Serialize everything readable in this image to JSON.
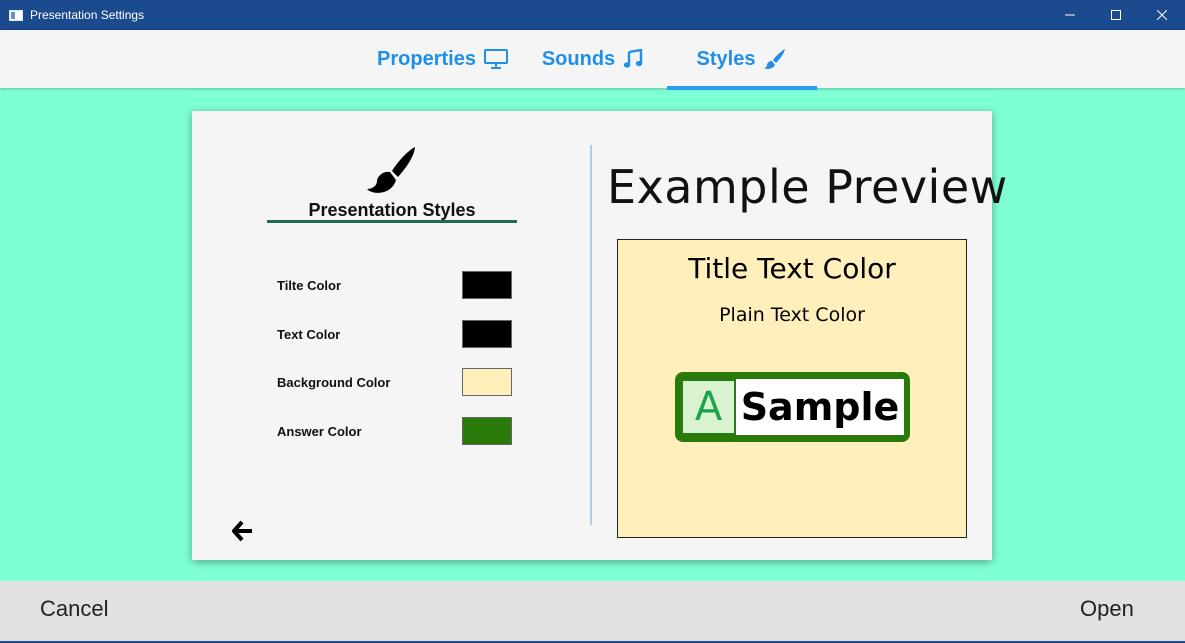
{
  "window": {
    "title": "Presentation Settings",
    "controls": {
      "minimize": "—",
      "maximize": "☐",
      "close": "✕"
    }
  },
  "tabs": [
    {
      "label": "Properties",
      "icon": "monitor-icon",
      "active": false
    },
    {
      "label": "Sounds",
      "icon": "music-note-icon",
      "active": false
    },
    {
      "label": "Styles",
      "icon": "paint-brush-icon",
      "active": true
    }
  ],
  "styles_panel": {
    "heading": "Presentation Styles",
    "rows": [
      {
        "label": "Tilte Color",
        "color": "#000000"
      },
      {
        "label": "Text Color",
        "color": "#000000"
      },
      {
        "label": "Background Color",
        "color": "#ffefbb"
      },
      {
        "label": "Answer Color",
        "color": "#2a7a0a"
      }
    ]
  },
  "preview": {
    "heading": "Example Preview",
    "title_text": "Title Text Color",
    "plain_text": "Plain Text Color",
    "answer_letter": "A",
    "answer_text": "Sample"
  },
  "footer": {
    "cancel_label": "Cancel",
    "open_label": "Open"
  },
  "colors": {
    "accent": "#1f8fe8",
    "page_background": "#7fffd4",
    "titlebar": "#1b4a8f"
  }
}
